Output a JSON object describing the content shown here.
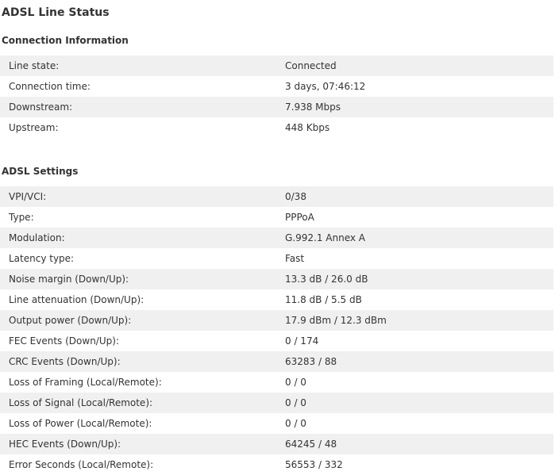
{
  "page": {
    "title": "ADSL Line Status"
  },
  "connection": {
    "title": "Connection Information",
    "rows": [
      {
        "label": "Line state:",
        "value": "Connected"
      },
      {
        "label": "Connection time:",
        "value": "3 days, 07:46:12"
      },
      {
        "label": "Downstream:",
        "value": "7.938 Mbps"
      },
      {
        "label": "Upstream:",
        "value": "448 Kbps"
      }
    ]
  },
  "adsl": {
    "title": "ADSL Settings",
    "rows": [
      {
        "label": "VPI/VCI:",
        "value": "0/38"
      },
      {
        "label": "Type:",
        "value": "PPPoA"
      },
      {
        "label": "Modulation:",
        "value": "G.992.1 Annex A"
      },
      {
        "label": "Latency type:",
        "value": "Fast"
      },
      {
        "label": "Noise margin (Down/Up):",
        "value": "13.3 dB / 26.0 dB"
      },
      {
        "label": "Line attenuation (Down/Up):",
        "value": "11.8 dB / 5.5 dB"
      },
      {
        "label": "Output power (Down/Up):",
        "value": "17.9 dBm / 12.3 dBm"
      },
      {
        "label": "FEC Events (Down/Up):",
        "value": "0 / 174"
      },
      {
        "label": "CRC Events (Down/Up):",
        "value": "63283 / 88"
      },
      {
        "label": "Loss of Framing (Local/Remote):",
        "value": "0 / 0"
      },
      {
        "label": "Loss of Signal (Local/Remote):",
        "value": "0 / 0"
      },
      {
        "label": "Loss of Power (Local/Remote):",
        "value": "0 / 0"
      },
      {
        "label": "HEC Events (Down/Up):",
        "value": "64245 / 48"
      },
      {
        "label": "Error Seconds (Local/Remote):",
        "value": "56553 / 332"
      }
    ]
  }
}
